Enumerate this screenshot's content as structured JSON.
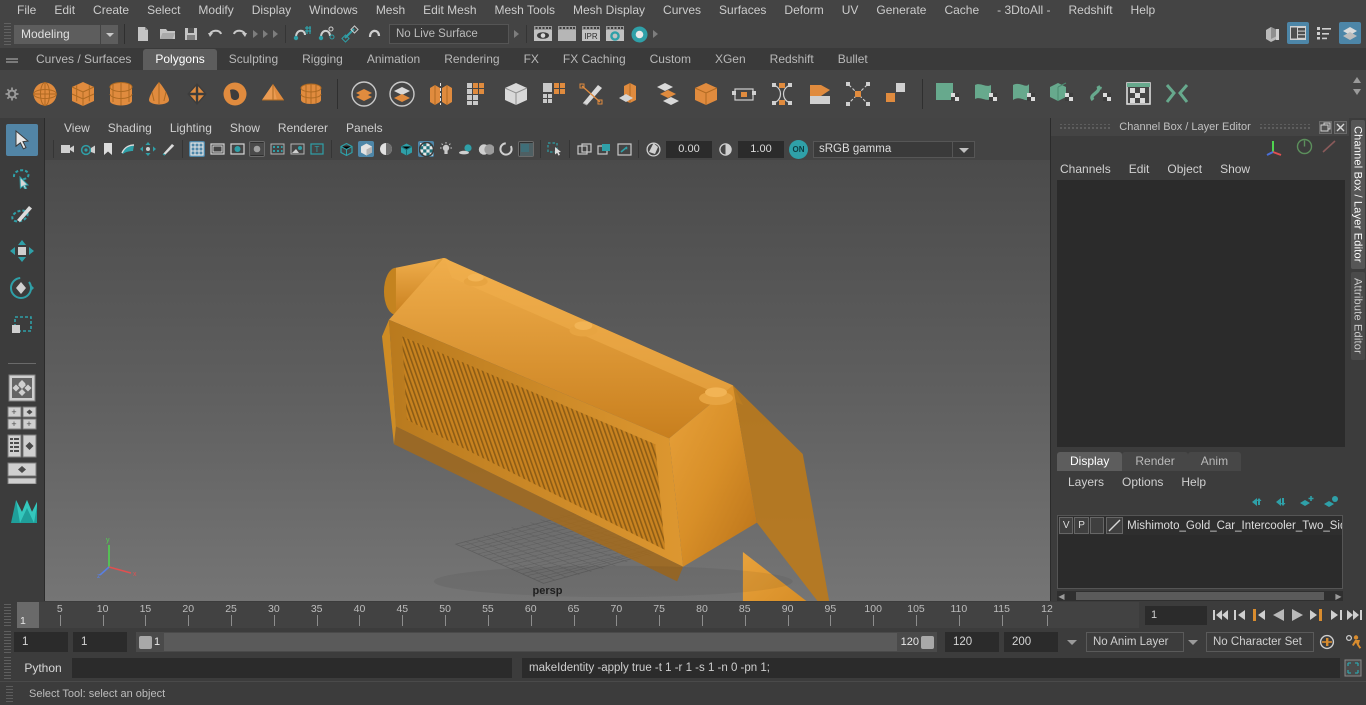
{
  "app": {
    "title": "Autodesk Maya",
    "menu_mode": "Modeling"
  },
  "menubar": {
    "items": [
      "File",
      "Edit",
      "Create",
      "Select",
      "Modify",
      "Display",
      "Windows",
      "Mesh",
      "Edit Mesh",
      "Mesh Tools",
      "Mesh Display",
      "Curves",
      "Surfaces",
      "Deform",
      "UV",
      "Generate",
      "Cache",
      "- 3DtoAll -",
      "Redshift",
      "Help"
    ]
  },
  "statusline": {
    "mode_label": "Modeling",
    "live_surface": "No Live Surface",
    "icons": [
      "new-scene-icon",
      "open-scene-icon",
      "save-scene-icon",
      "undo-icon",
      "redo-icon",
      "select-by-hierarchy-icon",
      "select-by-object-icon",
      "select-by-component-icon",
      "snap-to-grid-icon",
      "snap-to-curve-icon",
      "snap-to-point-icon",
      "snap-to-projected-center-icon",
      "snap-to-view-plane-icon",
      "make-live-icon",
      "render-view-icon",
      "render-current-frame-icon",
      "ipr-render-icon",
      "render-settings-icon",
      "hypershade-icon"
    ],
    "right_icons": [
      "show-hide-modeling-toolkit-icon",
      "show-hide-attribute-editor-icon",
      "show-hide-channel-box-icon",
      "show-hide-tool-settings-icon"
    ]
  },
  "shelf": {
    "tabs": [
      "Curves / Surfaces",
      "Polygons",
      "Sculpting",
      "Rigging",
      "Animation",
      "Rendering",
      "FX",
      "FX Caching",
      "Custom",
      "XGen",
      "Redshift",
      "Bullet"
    ],
    "active_tab": "Polygons",
    "buttons": [
      "polygon-sphere-icon",
      "polygon-cube-icon",
      "polygon-cylinder-icon",
      "polygon-cone-icon",
      "polygon-plane-icon",
      "polygon-torus-icon",
      "polygon-pyramid-icon",
      "polygon-prism-icon",
      "combine-icon",
      "separate-icon",
      "extract-icon",
      "mirror-icon",
      "boolean-icon",
      "smooth-icon",
      "sculpt-tool-icon",
      "extrude-icon",
      "bevel-icon",
      "bridge-icon",
      "append-polygon-icon",
      "quad-draw-icon",
      "insert-edge-loop-icon",
      "multi-cut-icon",
      "target-weld-icon",
      "offset-edge-loop-icon",
      "uv-planar-icon",
      "uv-cylindrical-icon",
      "uv-spherical-icon",
      "uv-automatic-icon",
      "uv-contour-stretch-icon",
      "uv-editor-icon",
      "uv-unfold-icon"
    ]
  },
  "toolbox": {
    "items": [
      "select-tool-icon",
      "lasso-select-tool-icon",
      "paint-select-tool-icon",
      "move-tool-icon",
      "rotate-tool-icon",
      "scale-tool-icon",
      "last-tool-icon",
      "four-view-layout-icon",
      "persp-outliner-layout-icon",
      "persp-graph-layout-icon",
      "single-perspective-layout-icon",
      "hypershade-layout-icon",
      "maya-logo-icon"
    ],
    "active": "select-tool-icon"
  },
  "viewport": {
    "menu": [
      "View",
      "Shading",
      "Lighting",
      "Show",
      "Renderer",
      "Panels"
    ],
    "camera_label": "persp",
    "toolbar": {
      "exposure_value": "0.00",
      "gamma_value": "1.00",
      "color_space": "sRGB gamma",
      "toggle_on_label": "ON",
      "icons": [
        "select-camera-icon",
        "camera-attributes-icon",
        "bookmark-icon",
        "image-plane-icon",
        "two-d-pan-zoom-icon",
        "grease-pencil-icon",
        "grid-icon",
        "film-gate-icon",
        "resolution-gate-icon",
        "gate-mask-icon",
        "exposure-icon",
        "xray-icon",
        "texture-placement-icon",
        "wireframe-icon",
        "smooth-shade-icon",
        "smooth-shade-all-icon",
        "wireframe-on-shaded-icon",
        "texture-icon",
        "use-all-lights-icon",
        "shadows-icon",
        "screen-space-ao-icon",
        "motion-blur-icon",
        "multisample-icon",
        "depth-of-field-icon",
        "isolate-select-icon",
        "select-mask-icon",
        "xray-joints-icon",
        "xray-active-components-icon",
        "exposure-settings-icon"
      ]
    },
    "axis_labels": {
      "x": "x",
      "y": "y",
      "z": "z"
    }
  },
  "channel_box": {
    "panel_title": "Channel Box / Layer Editor",
    "menus": [
      "Channels",
      "Edit",
      "Object",
      "Show"
    ],
    "vertical_tabs": [
      "Channel Box / Layer Editor",
      "Attribute Editor"
    ],
    "window_buttons": [
      "undock-panel-icon",
      "close-panel-icon"
    ]
  },
  "layer_editor": {
    "tabs": [
      "Display",
      "Render",
      "Anim"
    ],
    "active_tab": "Display",
    "menus": [
      "Layers",
      "Options",
      "Help"
    ],
    "toolbar_icons": [
      "move-layer-up-icon",
      "move-layer-down-icon",
      "new-layer-from-selected-icon",
      "new-layer-icon"
    ],
    "layers": [
      {
        "visibility": "V",
        "playback": "P",
        "lock": "",
        "name": "Mishimoto_Gold_Car_Intercooler_Two_Side"
      }
    ]
  },
  "timeline": {
    "current_frame": "1",
    "frame_field": "1",
    "ticks": [
      5,
      10,
      15,
      20,
      25,
      30,
      35,
      40,
      45,
      50,
      55,
      60,
      65,
      70,
      75,
      80,
      85,
      90,
      95,
      100,
      105,
      110,
      115
    ],
    "end_label": "12",
    "playback_icons": [
      "go-to-start-icon",
      "step-back-keyframe-icon",
      "step-back-frame-icon",
      "play-backwards-icon",
      "play-forwards-icon",
      "step-forward-frame-icon",
      "step-forward-keyframe-icon",
      "go-to-end-icon"
    ]
  },
  "range_slider": {
    "anim_start": "1",
    "range_start": "1",
    "range_bar_start": "1",
    "range_bar_end": "120",
    "range_end": "120",
    "anim_end": "200",
    "anim_layer": "No Anim Layer",
    "character_set": "No Character Set",
    "icons": [
      "auto-keyframe-icon",
      "animation-preferences-icon"
    ]
  },
  "command_line": {
    "language_label": "Python",
    "input_value": "",
    "output_text": "makeIdentity -apply true -t 1 -r 1 -s 1 -n 0 -pn 1;",
    "script_editor_icon": "script-editor-icon"
  },
  "help_line": {
    "text": "Select Tool: select an object"
  },
  "colors": {
    "accent_teal": "#2fa0a8",
    "accent_orange": "#d78a3c",
    "model_gold": "#d8912c",
    "selection_blue": "#5285a6",
    "panel_bg": "#3c3c3c",
    "shelf_bg": "#454545"
  }
}
